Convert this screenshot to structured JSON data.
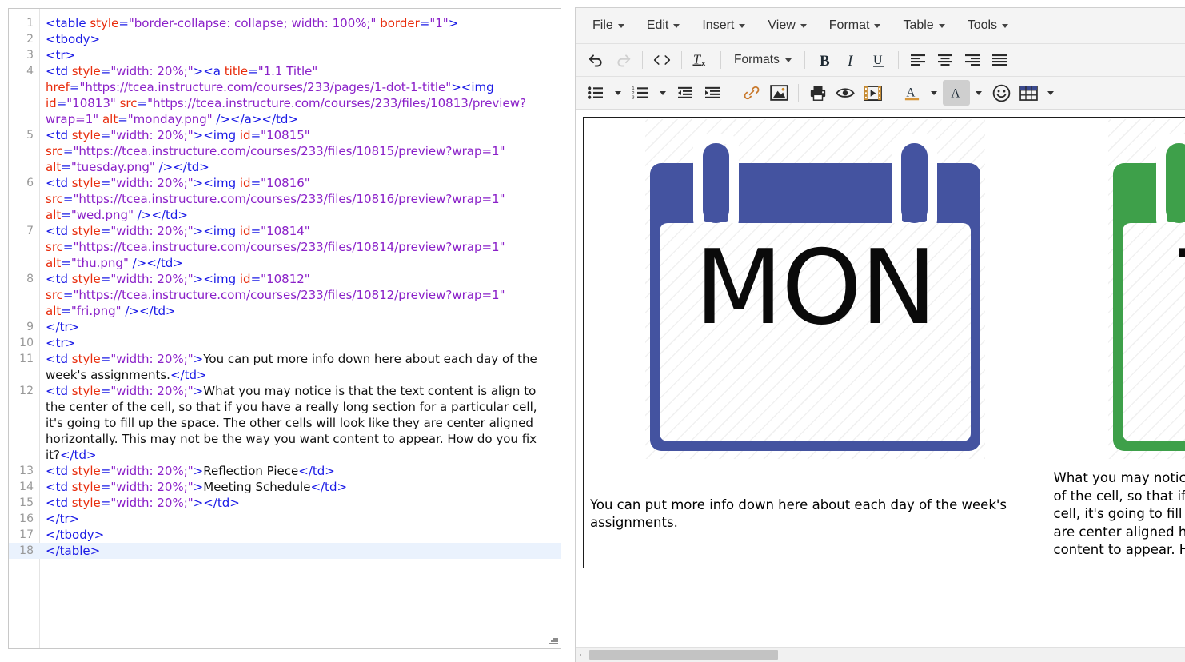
{
  "code_editor": {
    "name": "html-source-code-editor",
    "active_line": 18,
    "lines": [
      {
        "n": "1",
        "tokens": [
          {
            "t": "tg",
            "s": "<table "
          },
          {
            "t": "at",
            "s": "style"
          },
          {
            "t": "tg",
            "s": "="
          },
          {
            "t": "vl",
            "s": "\"border-collapse: collapse; width: 100%;\""
          },
          {
            "t": "tg",
            "s": " "
          },
          {
            "t": "at",
            "s": "border"
          },
          {
            "t": "tg",
            "s": "="
          },
          {
            "t": "vl",
            "s": "\"1\""
          },
          {
            "t": "tg",
            "s": ">"
          }
        ]
      },
      {
        "n": "2",
        "tokens": [
          {
            "t": "tg",
            "s": "<tbody>"
          }
        ]
      },
      {
        "n": "3",
        "tokens": [
          {
            "t": "tg",
            "s": "<tr>"
          }
        ]
      },
      {
        "n": "4",
        "tokens": [
          {
            "t": "tg",
            "s": "<td "
          },
          {
            "t": "at",
            "s": "style"
          },
          {
            "t": "tg",
            "s": "="
          },
          {
            "t": "vl",
            "s": "\"width: 20%;\""
          },
          {
            "t": "tg",
            "s": "><a "
          },
          {
            "t": "at",
            "s": "title"
          },
          {
            "t": "tg",
            "s": "="
          },
          {
            "t": "vl",
            "s": "\"1.1 Title\""
          },
          {
            "t": "tg",
            "s": " "
          },
          {
            "t": "at",
            "s": "href"
          },
          {
            "t": "tg",
            "s": "="
          },
          {
            "t": "vl",
            "s": "\"https://tcea.instructure.com/courses/233/pages/1-dot-1-title\""
          },
          {
            "t": "tg",
            "s": "><img "
          },
          {
            "t": "at",
            "s": "id"
          },
          {
            "t": "tg",
            "s": "="
          },
          {
            "t": "vl",
            "s": "\"10813\""
          },
          {
            "t": "tg",
            "s": " "
          },
          {
            "t": "at",
            "s": "src"
          },
          {
            "t": "tg",
            "s": "="
          },
          {
            "t": "vl",
            "s": "\"https://tcea.instructure.com/courses/233/files/10813/preview?wrap=1\""
          },
          {
            "t": "tg",
            "s": " "
          },
          {
            "t": "at",
            "s": "alt"
          },
          {
            "t": "tg",
            "s": "="
          },
          {
            "t": "vl",
            "s": "\"monday.png\""
          },
          {
            "t": "tg",
            "s": " /></a></td>"
          }
        ]
      },
      {
        "n": "5",
        "tokens": [
          {
            "t": "tg",
            "s": "<td "
          },
          {
            "t": "at",
            "s": "style"
          },
          {
            "t": "tg",
            "s": "="
          },
          {
            "t": "vl",
            "s": "\"width: 20%;\""
          },
          {
            "t": "tg",
            "s": "><img "
          },
          {
            "t": "at",
            "s": "id"
          },
          {
            "t": "tg",
            "s": "="
          },
          {
            "t": "vl",
            "s": "\"10815\""
          },
          {
            "t": "tg",
            "s": " "
          },
          {
            "t": "at",
            "s": "src"
          },
          {
            "t": "tg",
            "s": "="
          },
          {
            "t": "vl",
            "s": "\"https://tcea.instructure.com/courses/233/files/10815/preview?wrap=1\""
          },
          {
            "t": "tg",
            "s": " "
          },
          {
            "t": "at",
            "s": "alt"
          },
          {
            "t": "tg",
            "s": "="
          },
          {
            "t": "vl",
            "s": "\"tuesday.png\""
          },
          {
            "t": "tg",
            "s": " /></td>"
          }
        ]
      },
      {
        "n": "6",
        "tokens": [
          {
            "t": "tg",
            "s": "<td "
          },
          {
            "t": "at",
            "s": "style"
          },
          {
            "t": "tg",
            "s": "="
          },
          {
            "t": "vl",
            "s": "\"width: 20%;\""
          },
          {
            "t": "tg",
            "s": "><img "
          },
          {
            "t": "at",
            "s": "id"
          },
          {
            "t": "tg",
            "s": "="
          },
          {
            "t": "vl",
            "s": "\"10816\""
          },
          {
            "t": "tg",
            "s": " "
          },
          {
            "t": "at",
            "s": "src"
          },
          {
            "t": "tg",
            "s": "="
          },
          {
            "t": "vl",
            "s": "\"https://tcea.instructure.com/courses/233/files/10816/preview?wrap=1\""
          },
          {
            "t": "tg",
            "s": " "
          },
          {
            "t": "at",
            "s": "alt"
          },
          {
            "t": "tg",
            "s": "="
          },
          {
            "t": "vl",
            "s": "\"wed.png\""
          },
          {
            "t": "tg",
            "s": " /></td>"
          }
        ]
      },
      {
        "n": "7",
        "tokens": [
          {
            "t": "tg",
            "s": "<td "
          },
          {
            "t": "at",
            "s": "style"
          },
          {
            "t": "tg",
            "s": "="
          },
          {
            "t": "vl",
            "s": "\"width: 20%;\""
          },
          {
            "t": "tg",
            "s": "><img "
          },
          {
            "t": "at",
            "s": "id"
          },
          {
            "t": "tg",
            "s": "="
          },
          {
            "t": "vl",
            "s": "\"10814\""
          },
          {
            "t": "tg",
            "s": " "
          },
          {
            "t": "at",
            "s": "src"
          },
          {
            "t": "tg",
            "s": "="
          },
          {
            "t": "vl",
            "s": "\"https://tcea.instructure.com/courses/233/files/10814/preview?wrap=1\""
          },
          {
            "t": "tg",
            "s": " "
          },
          {
            "t": "at",
            "s": "alt"
          },
          {
            "t": "tg",
            "s": "="
          },
          {
            "t": "vl",
            "s": "\"thu.png\""
          },
          {
            "t": "tg",
            "s": " /></td>"
          }
        ]
      },
      {
        "n": "8",
        "tokens": [
          {
            "t": "tg",
            "s": "<td "
          },
          {
            "t": "at",
            "s": "style"
          },
          {
            "t": "tg",
            "s": "="
          },
          {
            "t": "vl",
            "s": "\"width: 20%;\""
          },
          {
            "t": "tg",
            "s": "><img "
          },
          {
            "t": "at",
            "s": "id"
          },
          {
            "t": "tg",
            "s": "="
          },
          {
            "t": "vl",
            "s": "\"10812\""
          },
          {
            "t": "tg",
            "s": " "
          },
          {
            "t": "at",
            "s": "src"
          },
          {
            "t": "tg",
            "s": "="
          },
          {
            "t": "vl",
            "s": "\"https://tcea.instructure.com/courses/233/files/10812/preview?wrap=1\""
          },
          {
            "t": "tg",
            "s": " "
          },
          {
            "t": "at",
            "s": "alt"
          },
          {
            "t": "tg",
            "s": "="
          },
          {
            "t": "vl",
            "s": "\"fri.png\""
          },
          {
            "t": "tg",
            "s": " /></td>"
          }
        ]
      },
      {
        "n": "9",
        "tokens": [
          {
            "t": "tg",
            "s": "</tr>"
          }
        ]
      },
      {
        "n": "10",
        "tokens": [
          {
            "t": "tg",
            "s": "<tr>"
          }
        ]
      },
      {
        "n": "11",
        "tokens": [
          {
            "t": "tg",
            "s": "<td "
          },
          {
            "t": "at",
            "s": "style"
          },
          {
            "t": "tg",
            "s": "="
          },
          {
            "t": "vl",
            "s": "\"width: 20%;\""
          },
          {
            "t": "tg",
            "s": ">"
          },
          {
            "t": "tx",
            "s": "You can put more info down here about each day of the week's assignments."
          },
          {
            "t": "tg",
            "s": "</td>"
          }
        ]
      },
      {
        "n": "12",
        "tokens": [
          {
            "t": "tg",
            "s": "<td "
          },
          {
            "t": "at",
            "s": "style"
          },
          {
            "t": "tg",
            "s": "="
          },
          {
            "t": "vl",
            "s": "\"width: 20%;\""
          },
          {
            "t": "tg",
            "s": ">"
          },
          {
            "t": "tx",
            "s": "What you may notice is that the text content is align to the center of the cell, so that if you have a really long section for a particular cell, it's going to fill up the space. The other cells will look like they are center aligned horizontally. This may not be the way you want content to appear. How do you fix it?"
          },
          {
            "t": "tg",
            "s": "</td>"
          }
        ]
      },
      {
        "n": "13",
        "tokens": [
          {
            "t": "tg",
            "s": "<td "
          },
          {
            "t": "at",
            "s": "style"
          },
          {
            "t": "tg",
            "s": "="
          },
          {
            "t": "vl",
            "s": "\"width: 20%;\""
          },
          {
            "t": "tg",
            "s": ">"
          },
          {
            "t": "tx",
            "s": "Reflection Piece"
          },
          {
            "t": "tg",
            "s": "</td>"
          }
        ]
      },
      {
        "n": "14",
        "tokens": [
          {
            "t": "tg",
            "s": "<td "
          },
          {
            "t": "at",
            "s": "style"
          },
          {
            "t": "tg",
            "s": "="
          },
          {
            "t": "vl",
            "s": "\"width: 20%;\""
          },
          {
            "t": "tg",
            "s": ">"
          },
          {
            "t": "tx",
            "s": "Meeting Schedule"
          },
          {
            "t": "tg",
            "s": "</td>"
          }
        ]
      },
      {
        "n": "15",
        "tokens": [
          {
            "t": "tg",
            "s": "<td "
          },
          {
            "t": "at",
            "s": "style"
          },
          {
            "t": "tg",
            "s": "="
          },
          {
            "t": "vl",
            "s": "\"width: 20%;\""
          },
          {
            "t": "tg",
            "s": "></td>"
          }
        ]
      },
      {
        "n": "16",
        "tokens": [
          {
            "t": "tg",
            "s": "</tr>"
          }
        ]
      },
      {
        "n": "17",
        "tokens": [
          {
            "t": "tg",
            "s": "</tbody>"
          }
        ]
      },
      {
        "n": "18",
        "tokens": [
          {
            "t": "tg",
            "s": "</table>"
          }
        ]
      }
    ]
  },
  "editor": {
    "menubar": [
      {
        "label": "File",
        "name": "menu-file"
      },
      {
        "label": "Edit",
        "name": "menu-edit"
      },
      {
        "label": "Insert",
        "name": "menu-insert"
      },
      {
        "label": "View",
        "name": "menu-view"
      },
      {
        "label": "Format",
        "name": "menu-format"
      },
      {
        "label": "Table",
        "name": "menu-table"
      },
      {
        "label": "Tools",
        "name": "menu-tools"
      }
    ],
    "toolbar_row1": {
      "undo": "undo-icon",
      "redo": "redo-icon",
      "source_code": "source-code-icon",
      "clear_formatting": "clear-formatting-icon",
      "formats_label": "Formats",
      "bold": "bold-icon",
      "italic": "italic-icon",
      "underline": "underline-icon",
      "align_left": "align-left-icon",
      "align_center": "align-center-icon",
      "align_right": "align-right-icon",
      "align_justify": "align-justify-icon"
    },
    "toolbar_row2": {
      "bullet_list": "bullet-list-icon",
      "numbered_list": "numbered-list-icon",
      "outdent": "outdent-icon",
      "indent": "indent-icon",
      "link": "link-icon",
      "image": "image-icon",
      "print": "print-icon",
      "preview": "preview-eye-icon",
      "media": "media-film-icon",
      "text_color": "text-color-icon",
      "background_color": "background-color-icon",
      "emoticon": "emoticon-icon",
      "table": "table-grid-icon"
    },
    "content": {
      "cells_row1": [
        {
          "name": "calendar-monday",
          "label": "MON",
          "color": "#4453a0",
          "alt": "monday.png"
        },
        {
          "name": "calendar-tuesday",
          "label": "TUE",
          "color": "#3ea04a",
          "alt": "tuesday.png"
        }
      ],
      "cells_row2": [
        {
          "name": "cell-monday-text",
          "text": "You can put more info down here about each day of the week's assignments."
        },
        {
          "name": "cell-tuesday-text",
          "text": "What you may notice is that the text content is align to the center of the cell, so that if you have a really long section for a particular cell, it's going to fill up the space. The other cells will look like they are center aligned horizontally. This may not be the way you want content to appear. How do you fix it?"
        }
      ]
    }
  }
}
